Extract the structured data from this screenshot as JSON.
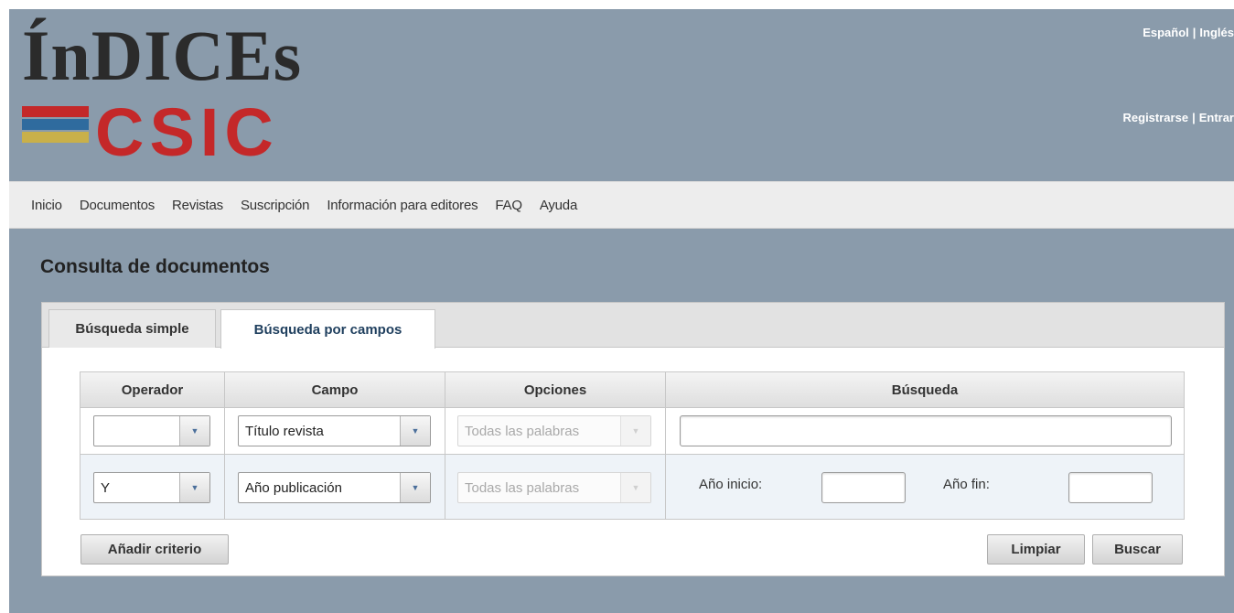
{
  "header": {
    "logo_top": "ÍnDICEs",
    "logo_bottom": "CSIC",
    "stripe_colors": [
      "#c42829",
      "#2f6b9e",
      "#c9b04a"
    ],
    "lang_links": [
      "Español",
      "Inglés"
    ],
    "user_links": [
      "Registrarse",
      "Entrar"
    ]
  },
  "nav": {
    "items": [
      "Inicio",
      "Documentos",
      "Revistas",
      "Suscripción",
      "Información para editores",
      "FAQ",
      "Ayuda"
    ]
  },
  "page_title": "Consulta de documentos",
  "tabs": [
    {
      "label": "Búsqueda simple",
      "active": false
    },
    {
      "label": "Búsqueda por campos",
      "active": true
    }
  ],
  "grid": {
    "headers": [
      "Operador",
      "Campo",
      "Opciones",
      "Búsqueda"
    ],
    "rows": [
      {
        "operador": "",
        "campo": "Título revista",
        "opciones": "Todas las palabras",
        "busqueda": ""
      },
      {
        "operador": "Y",
        "campo": "Año publicación",
        "opciones": "Todas las palabras",
        "anio_inicio_label": "Año inicio:",
        "anio_inicio": "",
        "anio_fin_label": "Año fin:",
        "anio_fin": ""
      }
    ]
  },
  "buttons": {
    "add_criterion": "Añadir criterio",
    "clear": "Limpiar",
    "search": "Buscar"
  },
  "colors": {
    "background": "#8a9bab",
    "logo_red": "#c42829",
    "active_tab_text": "#1f3f5e"
  }
}
